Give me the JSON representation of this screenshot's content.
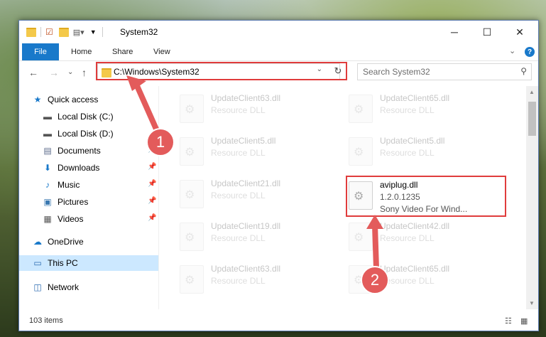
{
  "window": {
    "title": "System32",
    "controls": {
      "minimize": "─",
      "maximize": "☐",
      "close": "✕"
    }
  },
  "ribbon": {
    "file_label": "File",
    "tabs": [
      "Home",
      "Share",
      "View"
    ],
    "expand_glyph": "⌄",
    "help_glyph": "?"
  },
  "nav": {
    "back": "←",
    "forward": "→",
    "recent": "⌄",
    "up": "↑",
    "address": "C:\\Windows\\System32",
    "address_dropdown": "⌄",
    "refresh": "↻",
    "search_placeholder": "Search System32",
    "search_glyph": "⚲"
  },
  "sidebar": {
    "items": [
      {
        "label": "Quick access",
        "icon": "star-icon",
        "glyph": "★",
        "color": "#1979ca"
      },
      {
        "label": "Local Disk (C:)",
        "icon": "drive-icon",
        "glyph": "▬",
        "color": "#555"
      },
      {
        "label": "Local Disk (D:)",
        "icon": "drive-icon",
        "glyph": "▬",
        "color": "#555"
      },
      {
        "label": "Documents",
        "icon": "document-icon",
        "glyph": "▤",
        "color": "#5a6a8a"
      },
      {
        "label": "Downloads",
        "icon": "download-icon",
        "glyph": "⬇",
        "color": "#1979ca"
      },
      {
        "label": "Music",
        "icon": "music-icon",
        "glyph": "♪",
        "color": "#1979ca"
      },
      {
        "label": "Pictures",
        "icon": "pictures-icon",
        "glyph": "▣",
        "color": "#3a78b0"
      },
      {
        "label": "Videos",
        "icon": "videos-icon",
        "glyph": "▦",
        "color": "#555"
      },
      {
        "label": "OneDrive",
        "icon": "cloud-icon",
        "glyph": "☁",
        "color": "#1979ca"
      },
      {
        "label": "This PC",
        "icon": "computer-icon",
        "glyph": "▭",
        "color": "#2a6ab0"
      },
      {
        "label": "Network",
        "icon": "network-icon",
        "glyph": "◫",
        "color": "#2a6ab0"
      }
    ],
    "pin_glyph": "📌"
  },
  "files": [
    {
      "name": "UpdateClient63.dll",
      "sub": "Resource DLL"
    },
    {
      "name": "UpdateClient65.dll",
      "sub": "Resource DLL"
    },
    {
      "name": "UpdateClient5.dll",
      "sub": "Resource DLL"
    },
    {
      "name": "UpdateClient5.dll",
      "sub": "Resource DLL"
    },
    {
      "name": "UpdateClient21.dll",
      "sub": "Resource DLL"
    },
    {
      "name": "aviplug.dll",
      "sub": "1.2.0.1235",
      "sub2": "Sony Video For Wind..."
    },
    {
      "name": "UpdateClient19.dll",
      "sub": "Resource DLL"
    },
    {
      "name": "UpdateClient42.dll",
      "sub": "Resource DLL"
    },
    {
      "name": "UpdateClient63.dll",
      "sub": "Resource DLL"
    },
    {
      "name": "UpdateClient65.dll",
      "sub": "Resource DLL"
    }
  ],
  "status": {
    "items": "103 items"
  },
  "markers": {
    "one": "1",
    "two": "2"
  },
  "colors": {
    "accent": "#1979ca",
    "highlight": "#e03c3c",
    "marker": "#e35b5b"
  }
}
